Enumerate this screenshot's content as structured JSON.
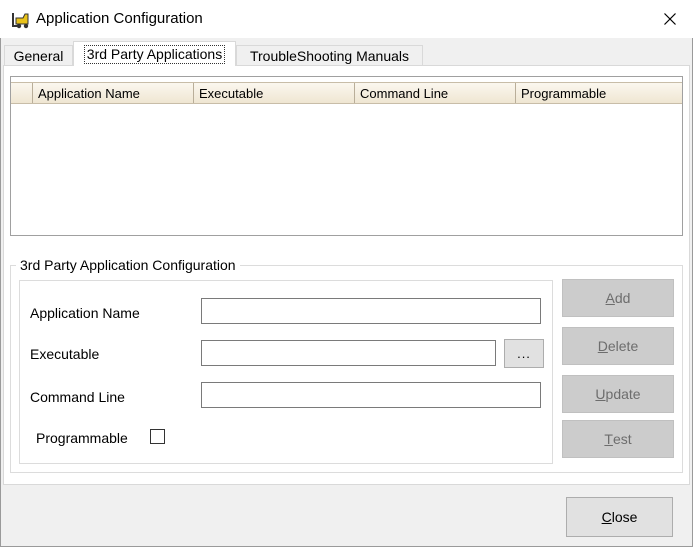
{
  "window": {
    "title": "Application Configuration"
  },
  "tabs": [
    {
      "label": "General"
    },
    {
      "label": "3rd Party Applications"
    },
    {
      "label": "TroubleShooting Manuals"
    }
  ],
  "grid": {
    "columns": [
      "Application Name",
      "Executable",
      "Command Line",
      "Programmable"
    ],
    "rows": []
  },
  "config": {
    "legend": "3rd Party Application Configuration",
    "app_name_label": "Application Name",
    "app_name_value": "",
    "executable_label": "Executable",
    "executable_value": "",
    "browse_label": "...",
    "command_line_label": "Command Line",
    "command_line_value": "",
    "programmable_label": "Programmable",
    "programmable_checked": false
  },
  "buttons": {
    "add": {
      "mnemonic": "A",
      "rest": "dd"
    },
    "delete": {
      "mnemonic": "D",
      "rest": "elete"
    },
    "update": {
      "mnemonic": "U",
      "rest": "pdate"
    },
    "test": {
      "mnemonic": "T",
      "rest": "est"
    },
    "close": {
      "mnemonic": "C",
      "rest": "lose"
    }
  },
  "icons": {
    "app": "forklift-icon",
    "close": "close-icon"
  }
}
